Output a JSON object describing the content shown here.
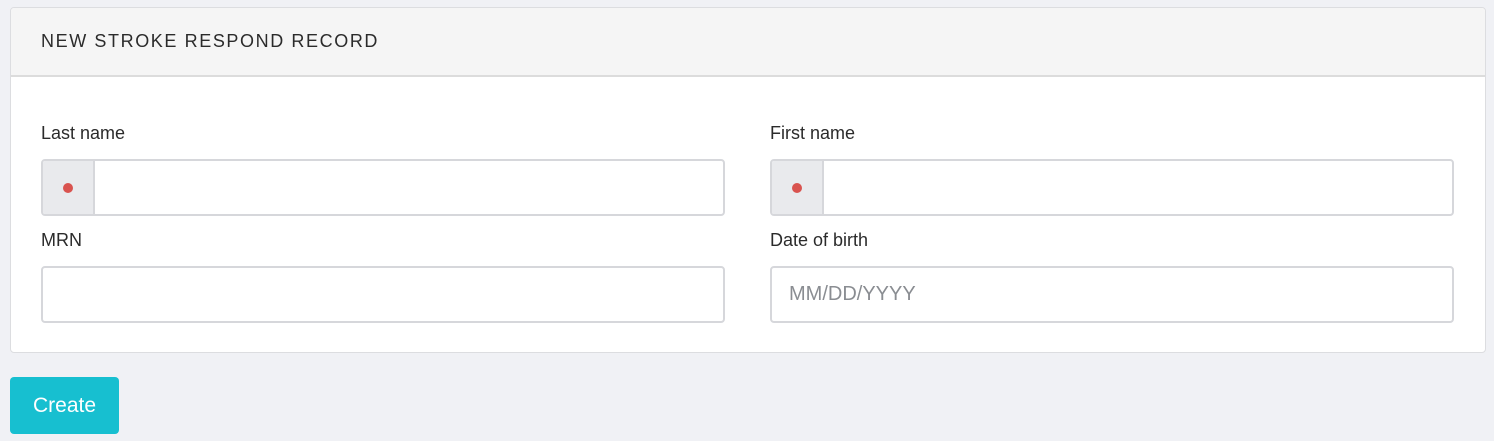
{
  "panel": {
    "title": "NEW STROKE RESPOND RECORD"
  },
  "fields": {
    "last_name": {
      "label": "Last name",
      "value": "",
      "required": true
    },
    "first_name": {
      "label": "First name",
      "value": "",
      "required": true
    },
    "mrn": {
      "label": "MRN",
      "value": ""
    },
    "dob": {
      "label": "Date of birth",
      "value": "",
      "placeholder": "MM/DD/YYYY"
    }
  },
  "actions": {
    "create_label": "Create"
  },
  "colors": {
    "accent": "#17bfd0",
    "required": "#d9534f",
    "background": "#f0f1f5"
  }
}
